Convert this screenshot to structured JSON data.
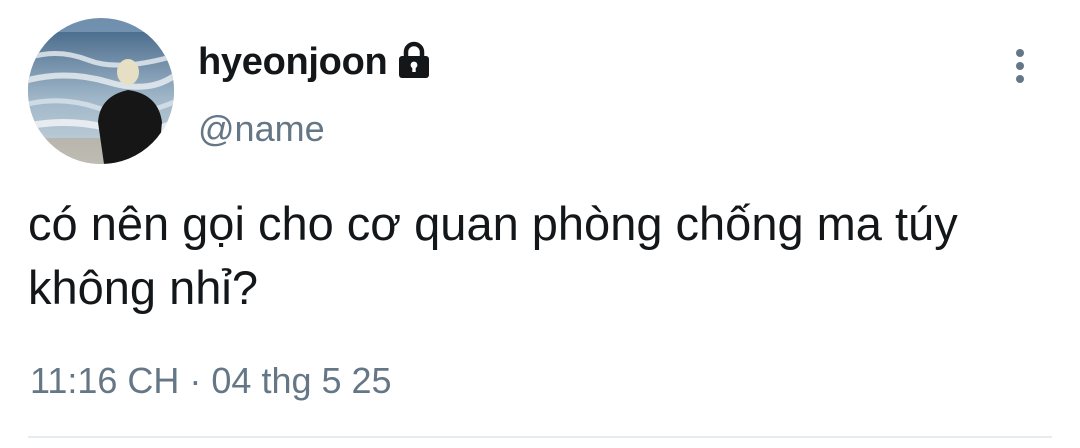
{
  "user": {
    "display_name": "hyeonjoon",
    "handle": "@name",
    "protected": true
  },
  "tweet": {
    "text": "có nên gọi cho cơ quan phòng chống ma túy không nhỉ?",
    "timestamp": "11:16 CH · 04 thg 5 25"
  },
  "icons": {
    "lock": "lock-icon",
    "more": "more-vertical-icon"
  },
  "colors": {
    "text_primary": "#14171a",
    "text_secondary": "#657786",
    "divider": "#e6ecf0",
    "background": "#ffffff"
  }
}
